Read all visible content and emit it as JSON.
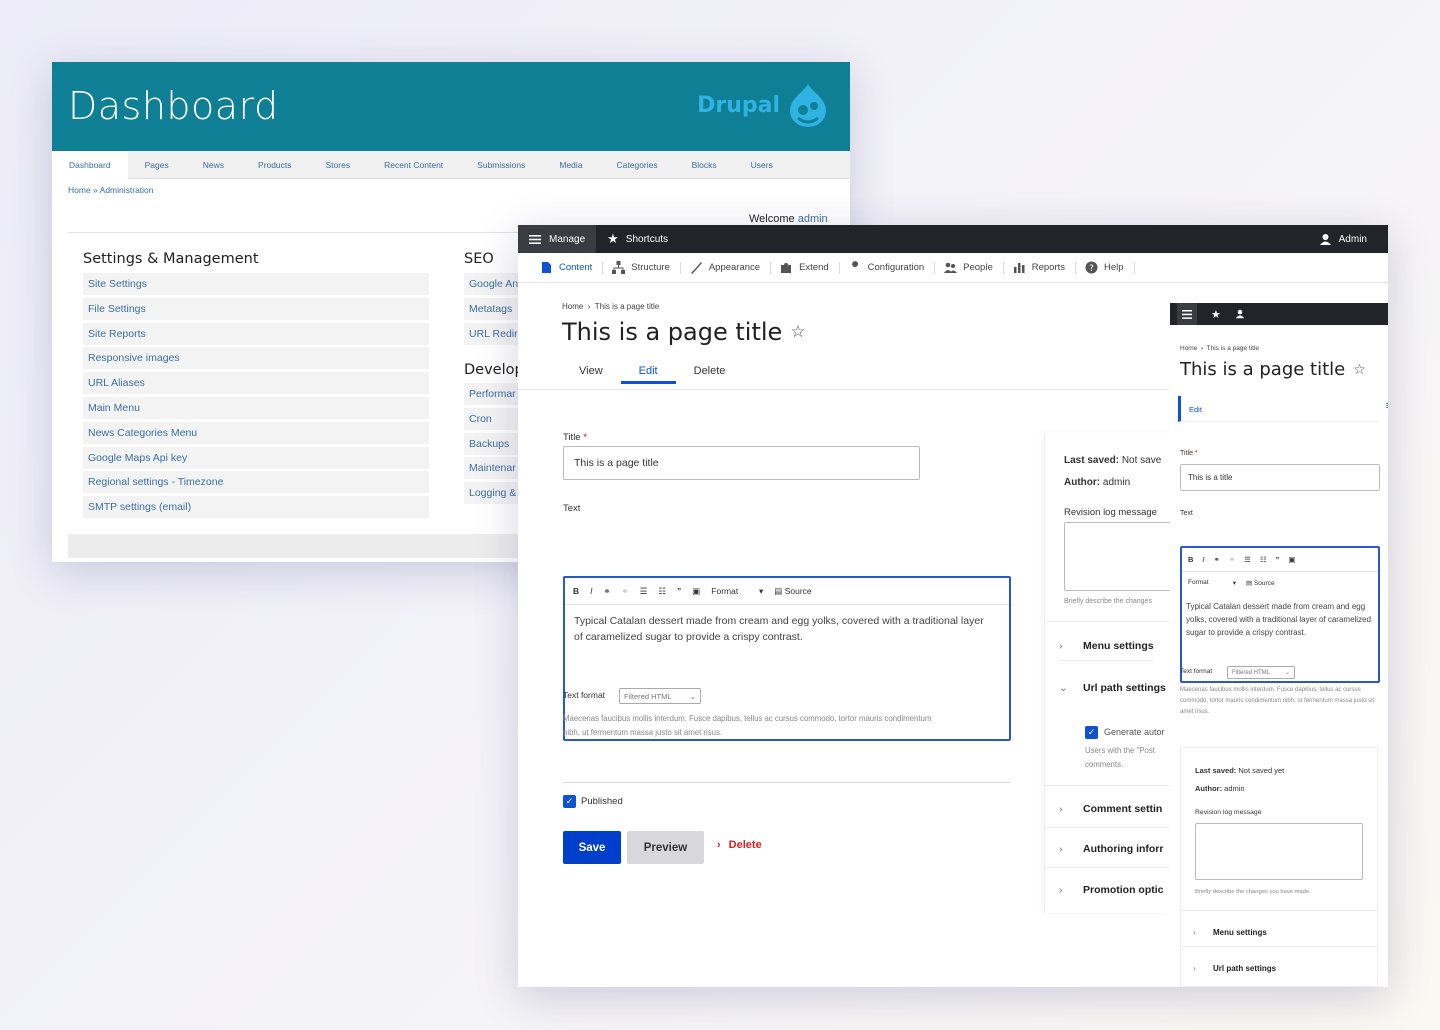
{
  "dashboard": {
    "title": "Dashboard",
    "brand": "Drupal",
    "tabs": [
      "Dashboard",
      "Pages",
      "News",
      "Products",
      "Stores",
      "Recent Content",
      "Submissions",
      "Media",
      "Categories",
      "Blocks",
      "Users"
    ],
    "breadcrumb": "Home » Administration",
    "welcome_prefix": "Welcome ",
    "welcome_user": "admin",
    "section_settings": "Settings & Management",
    "settings_links": [
      "Site Settings",
      "File Settings",
      "Site Reports",
      "Responsive images",
      "URL Aliases",
      "Main Menu",
      "News Categories Menu",
      "Google Maps Api key",
      "Regional settings - Timezone",
      "SMTP settings (email)"
    ],
    "section_seo": "SEO",
    "seo_links": [
      "Google An",
      "Metatags",
      "URL Redir"
    ],
    "section_develop": "Develop",
    "develop_links": [
      "Performar",
      "Cron",
      "Backups",
      "Maintenar",
      "Logging &"
    ]
  },
  "admin": {
    "toolbar": {
      "manage": "Manage",
      "shortcuts": "Shortcuts",
      "user": "Admin"
    },
    "tray": [
      "Content",
      "Structure",
      "Appearance",
      "Extend",
      "Configuration",
      "People",
      "Reports",
      "Help"
    ],
    "breadcrumb": {
      "home": "Home",
      "current": "This is a page title"
    },
    "page_title": "This is a page title",
    "local_tabs": [
      "View",
      "Edit",
      "Delete"
    ],
    "title_label": "Title",
    "title_value": "This is a page title",
    "text_label": "Text",
    "editor_format": "Format",
    "editor_source": "Source",
    "body_text": "Typical Catalan dessert made from cream and egg yolks, covered with a traditional layer of caramelized sugar to provide a crispy contrast.",
    "text_format_label": "Text format",
    "text_format_value": "Filtered HTML",
    "help_text": "Maecenas faucibus mollis interdum. Fusce dapibus, tellus ac cursus commodo, tortor mauris condimentum nibh, ut fermentum massa justo sit amet risus.",
    "published_label": "Published",
    "save": "Save",
    "preview": "Preview",
    "delete": "Delete",
    "meta": {
      "last_saved_label": "Last saved:",
      "last_saved_value": "Not save",
      "author_label": "Author:",
      "author_value": "admin",
      "revision_label": "Revision log message",
      "revision_help": "Briefly describe the changes"
    },
    "accordion": {
      "menu": "Menu settings",
      "url": "Url path settings",
      "generate": "Generate autor",
      "url_help": "Users with the \"Post comments.",
      "comment": "Comment settin",
      "authoring": "Authoring inforr",
      "promotion": "Promotion optic"
    }
  },
  "mobile": {
    "breadcrumb": {
      "home": "Home",
      "current": "This is a page title"
    },
    "page_title": "This is a page title",
    "tab": "Edit",
    "title_label": "Title",
    "title_value": "This is a title",
    "text_label": "Text",
    "editor_format": "Format",
    "editor_source": "Source",
    "body_text": "Typical Catalan dessert made from cream and egg yolks, covered with a traditional layer of caramelized sugar to provide a crispy contrast.",
    "text_format_label": "Text format",
    "text_format_value": "Filtered HTML",
    "help_text": "Maecenas faucibus mollis interdum. Fusce dapibus, tellus ac cursus commodo, tortor mauris condimentum nibh, ut fermentum massa justo sit amet risus.",
    "last_saved_label": "Last saved:",
    "last_saved_value": "Not saved yet",
    "author_label": "Author:",
    "author_value": "admin",
    "revision_label": "Revision log message",
    "revision_help": "Briefly describe the changes you have made.",
    "menu": "Menu settings",
    "url": "Url path settings"
  },
  "colors": {
    "teal": "#0e7f95",
    "drupal_blue": "#2fb3e3",
    "primary": "#003ecc",
    "toolbar": "#232429",
    "danger": "#d72222"
  }
}
